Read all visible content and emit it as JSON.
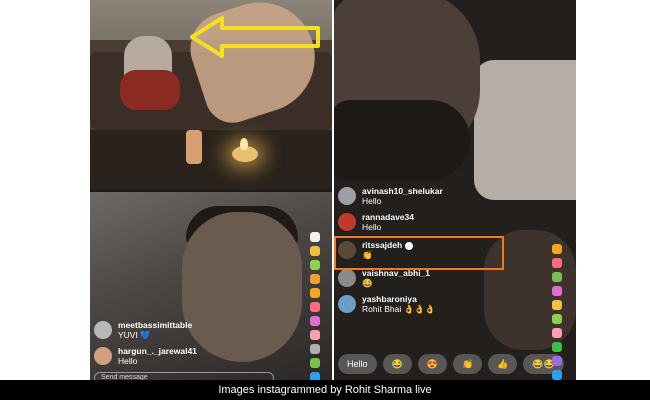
{
  "left_stream": {
    "comments": [
      {
        "user": "meetbassimittable",
        "text": "YUVI 💙",
        "avatar_color": "#b8b8b8"
      },
      {
        "user": "hargun_._jarewal41",
        "text": "Hello",
        "avatar_color": "#d0a080"
      }
    ],
    "input_placeholder": "Send message",
    "heart_colors": [
      "#f0f0f0",
      "#f0c040",
      "#8fd14f",
      "#f0a030",
      "#f5a623",
      "#ff6b81",
      "#e06fd0",
      "#ff9fb0",
      "#b0b0b0",
      "#78c050",
      "#2aa0f0",
      "#9c6fe0",
      "#2a7ff0"
    ]
  },
  "right_stream": {
    "comments": [
      {
        "user": "avinash10_shelukar",
        "text": "Hello",
        "avatar_color": "#9aa0a6"
      },
      {
        "user": "rannadave34",
        "text": "Hello",
        "avatar_color": "#c0392b"
      },
      {
        "user": "ritssajdeh",
        "text": "👏",
        "avatar_color": "#5a4a3a",
        "verified": true
      },
      {
        "user": "vaishnav_abhi_1",
        "text": "😂",
        "avatar_color": "#8a8a8a"
      },
      {
        "user": "yashbaroniya",
        "text": "Rohit Bhai 👌👌👌",
        "avatar_color": "#6aa0c8"
      }
    ],
    "quick_replies": [
      "Hello",
      "😂",
      "😍",
      "👏",
      "👍",
      "😂😂"
    ],
    "heart_colors": [
      "#f5a623",
      "#ff6b81",
      "#78c050",
      "#e06fd0",
      "#f0c040",
      "#8fd14f",
      "#ff9fb0",
      "#3bbf4a",
      "#9c6fe0",
      "#2aa0f0"
    ]
  },
  "caption": "Images instagrammed by Rohit Sharma live",
  "colors": {
    "highlight": "#f07a20",
    "arrow": "#f4e020"
  }
}
